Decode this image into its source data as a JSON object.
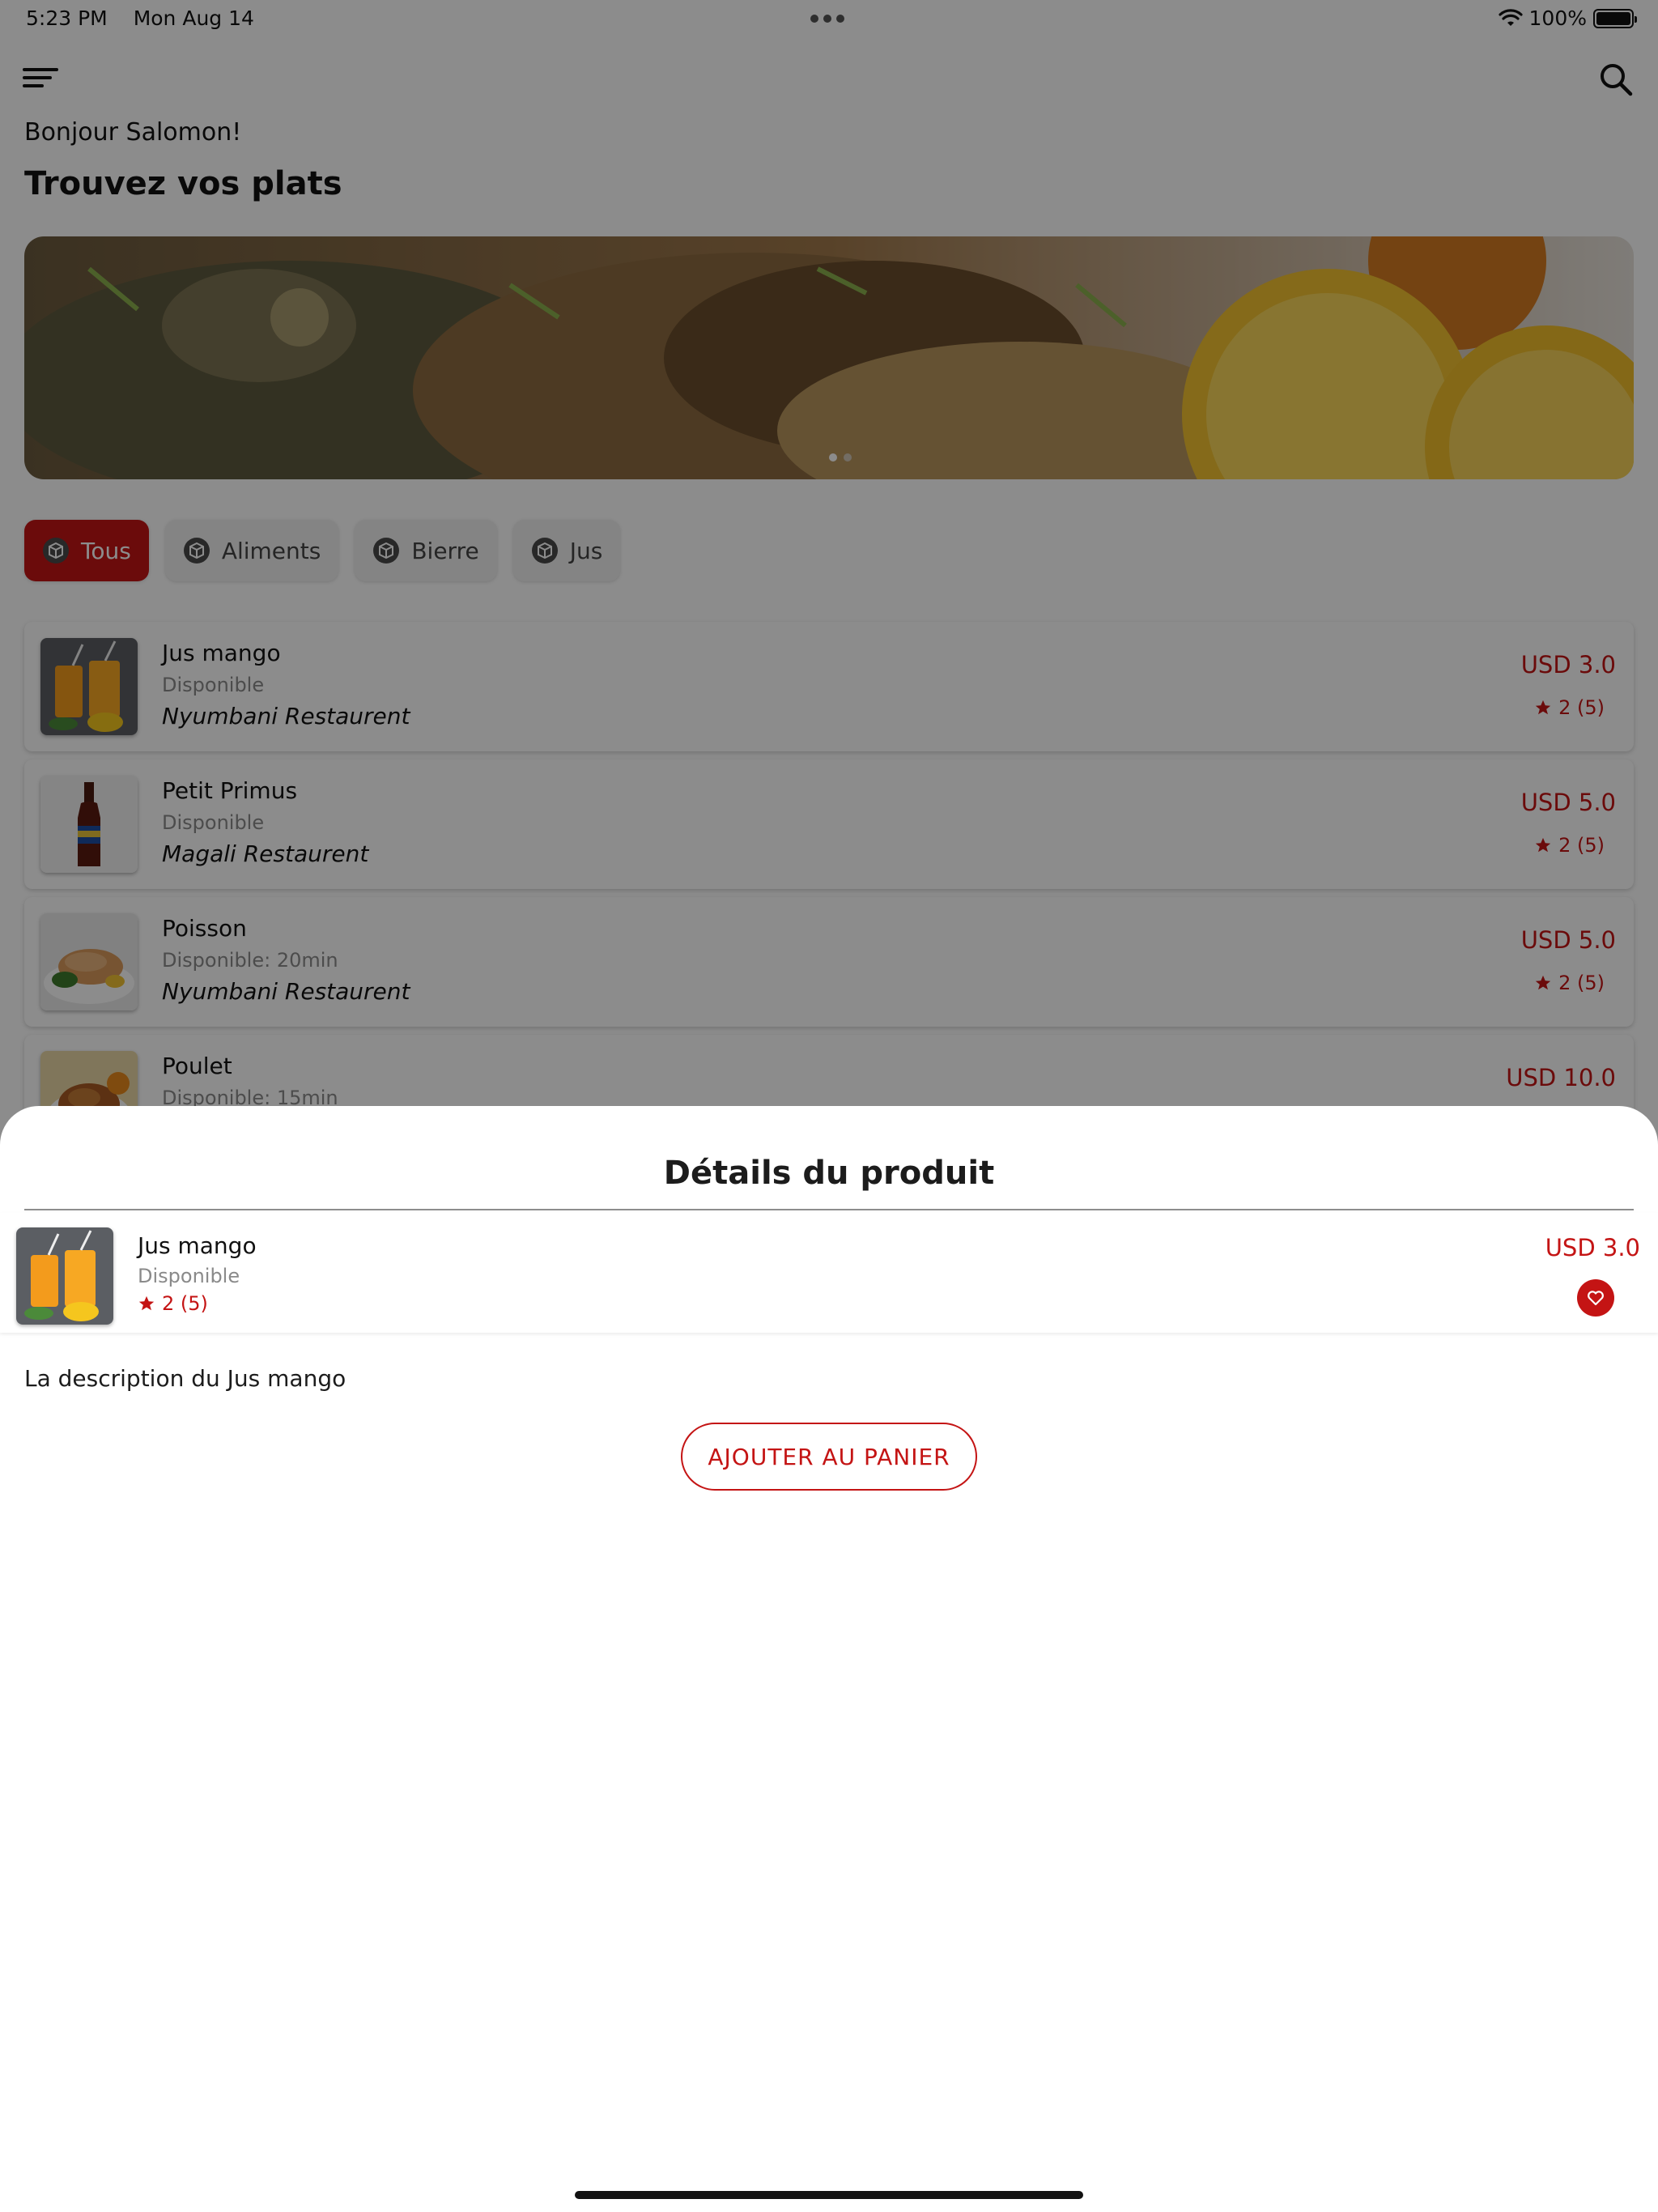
{
  "status_bar": {
    "time": "5:23 PM",
    "date": "Mon Aug 14",
    "battery": "100%"
  },
  "header": {
    "greeting": "Bonjour Salomon!",
    "title": "Trouvez vos plats"
  },
  "categories": [
    {
      "label": "Tous",
      "active": true
    },
    {
      "label": "Aliments",
      "active": false
    },
    {
      "label": "Bierre",
      "active": false
    },
    {
      "label": "Jus",
      "active": false
    }
  ],
  "products": [
    {
      "name": "Jus mango",
      "availability": "Disponible",
      "restaurant": "Nyumbani Restaurent",
      "price": "USD 3.0",
      "rating": "2 (5)",
      "icon": "mango-juice"
    },
    {
      "name": "Petit Primus",
      "availability": "Disponible",
      "restaurant": "Magali Restaurent",
      "price": "USD 5.0",
      "rating": "2 (5)",
      "icon": "beer-bottle"
    },
    {
      "name": "Poisson",
      "availability": "Disponible: 20min",
      "restaurant": "Nyumbani Restaurent",
      "price": "USD 5.0",
      "rating": "2 (5)",
      "icon": "fish-plate"
    },
    {
      "name": "Poulet",
      "availability": "Disponible: 15min",
      "restaurant": "",
      "price": "USD 10.0",
      "rating": "",
      "icon": "chicken-plate"
    }
  ],
  "sheet": {
    "title": "Détails du produit",
    "product": {
      "name": "Jus mango",
      "availability": "Disponible",
      "rating": "2 (5)",
      "price": "USD 3.0"
    },
    "description": "La description du Jus mango",
    "add_to_cart_label": "AJOUTER AU PANIER"
  },
  "colors": {
    "accent": "#c41414",
    "overlay": "rgba(0,0,0,0.45)"
  }
}
